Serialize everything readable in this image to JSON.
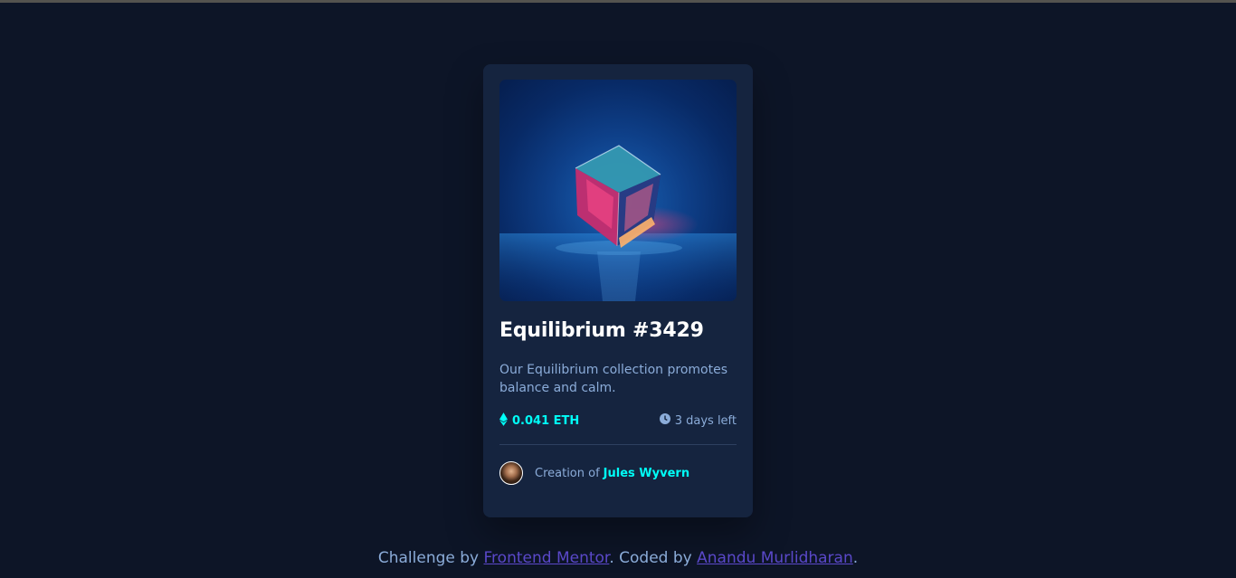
{
  "card": {
    "image_alt": "equilibrium-cube-image",
    "title": "Equilibrium #3429",
    "description": "Our Equilibrium collection promotes balance and calm.",
    "price": "0.041 ETH",
    "price_icon": "ethereum-icon",
    "time_left": "3 days left",
    "time_icon": "clock-icon",
    "creator_prefix": "Creation of",
    "creator_name": "Jules Wyvern"
  },
  "footer": {
    "prefix": "Challenge by",
    "link1": "Frontend Mentor",
    "middle": ". Coded by",
    "link2": "Anandu Murlidharan",
    "suffix": "."
  },
  "colors": {
    "background": "#0d1527",
    "card": "#15243f",
    "accent_cyan": "#00fff8",
    "soft_blue": "#8bacd9",
    "link_violet": "#5a48c9"
  }
}
